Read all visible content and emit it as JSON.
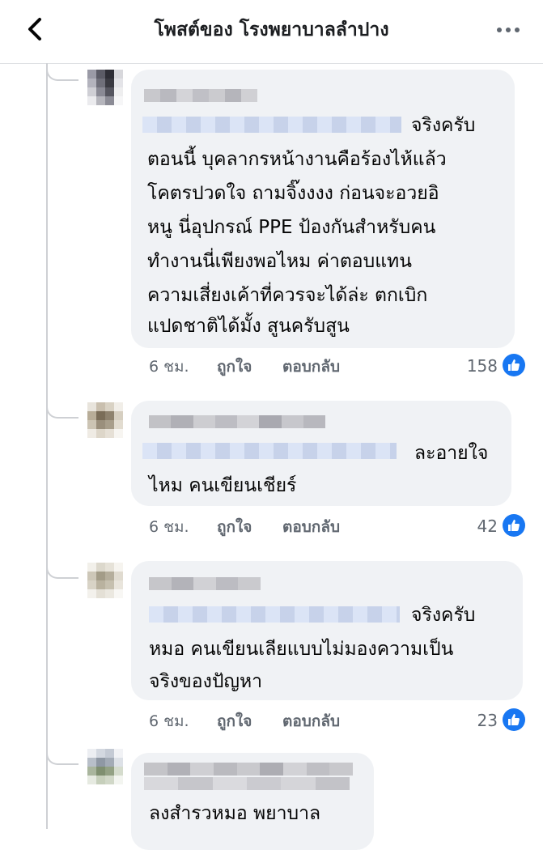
{
  "header": {
    "title": "โพสต์ของ โรงพยาบาลลำปาง",
    "back_icon": "chevron-left-icon",
    "more_icon": "more-horizontal-icon"
  },
  "actions": {
    "like_label": "ถูกใจ",
    "reply_label": "ตอบกลับ"
  },
  "comments": [
    {
      "text_lines": [
        "จริงครับ",
        "ตอนนี้ บุคลากรหน้างานคือร้องไห้แล้ว",
        "โคตรปวดใจ ถามจิ๊งงงง ก่อนจะอวยอิ",
        "หนู นี่อุปกรณ์ PPE ป้องกันสำหรับคน",
        "ทำงานนี่เพียงพอไหม ค่าตอบแทน",
        "ความเสี่ยงเค้าที่ควรจะได้ล่ะ ตกเบิก",
        "แปดชาติได้มั้ง สูนครับสูน"
      ],
      "time": "6 ชม.",
      "like_count": "158"
    },
    {
      "text_lines": [
        "ละอายใจ",
        "ไหม คนเขียนเชียร์"
      ],
      "time": "6 ชม.",
      "like_count": "42"
    },
    {
      "text_lines": [
        "จริงครับ",
        "หมอ คนเขียนเลียแบบไม่มองความเป็น",
        "จริงของปัญหา"
      ],
      "time": "6 ชม.",
      "like_count": "23"
    },
    {
      "text_lines": [
        "ลงสำรวหมอ พยาบาล"
      ]
    }
  ],
  "colors": {
    "bubble": "#f0f2f5",
    "like_blue": "#1877f2",
    "meta_gray": "#606770",
    "mention_blur": "#cfdbf3"
  }
}
